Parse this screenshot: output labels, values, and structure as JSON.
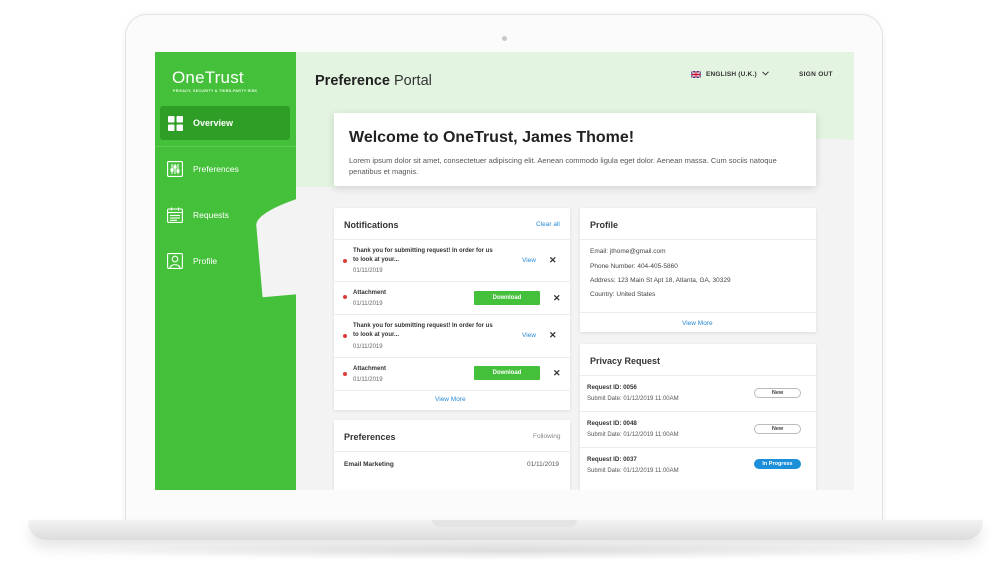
{
  "app": {
    "brand": "OneTrust",
    "brand_tagline": "PRIVACY, SECURITY & THIRD-PARTY RISK",
    "page_title_bold": "Preference",
    "page_title_rest": " Portal",
    "language": "ENGLISH (U.K.)",
    "sign_out": "SIGN OUT"
  },
  "sidebar": {
    "items": [
      {
        "label": "Overview",
        "icon": "grid-icon",
        "active": true
      },
      {
        "label": "Preferences",
        "icon": "sliders-icon",
        "active": false
      },
      {
        "label": "Requests",
        "icon": "calendar-icon",
        "active": false
      },
      {
        "label": "Profile",
        "icon": "user-icon",
        "active": false
      }
    ]
  },
  "welcome": {
    "title": "Welcome to OneTrust, James Thome!",
    "body": "Lorem ipsum dolor sit amet, consectetuer adipiscing elit. Aenean commodo ligula eget dolor. Aenean massa. Cum sociis natoque penatibus et magnis."
  },
  "notifications": {
    "title": "Notifications",
    "clear_all": "Clear all",
    "view_more": "View More",
    "items": [
      {
        "text": "Thank you for submitting request! In order for us to look at your...",
        "date": "01/11/2019",
        "action": "View"
      },
      {
        "text": "Attachment",
        "date": "01/11/2019",
        "action": "Download"
      },
      {
        "text": "Thank you for submitting request! In order for us to look at your...",
        "date": "01/11/2019",
        "action": "View"
      },
      {
        "text": "Attachment",
        "date": "01/11/2019",
        "action": "Download"
      }
    ],
    "close_glyph": "✕"
  },
  "preferences": {
    "title": "Preferences",
    "status": "Following",
    "items": [
      {
        "name": "Email Marketing",
        "date": "01/11/2019"
      }
    ]
  },
  "profile": {
    "title": "Profile",
    "email": "Email:  jthome@gmail.com",
    "phone": "Phone Number:  404-405-5860",
    "address": "Address:  123 Main St Apt 18, Atlanta, GA, 30329",
    "country": "Country:  United States",
    "view_more": "View More"
  },
  "privacy": {
    "title": "Privacy Request",
    "items": [
      {
        "id": "Request ID: 0056",
        "date": "Submit Date: 01/12/2019 11:00AM",
        "status": "New"
      },
      {
        "id": "Request ID: 0048",
        "date": "Submit Date: 01/12/2019 11:00AM",
        "status": "New"
      },
      {
        "id": "Request ID: 0037",
        "date": "Submit Date: 01/12/2019 11:00AM",
        "status": "In Progress"
      }
    ]
  },
  "colors": {
    "brand_green": "#45c03a",
    "active_green": "#2f9e27",
    "link_blue": "#2a8ad4",
    "status_blue": "#1b8fd9",
    "alert_red": "#e03b3b"
  }
}
